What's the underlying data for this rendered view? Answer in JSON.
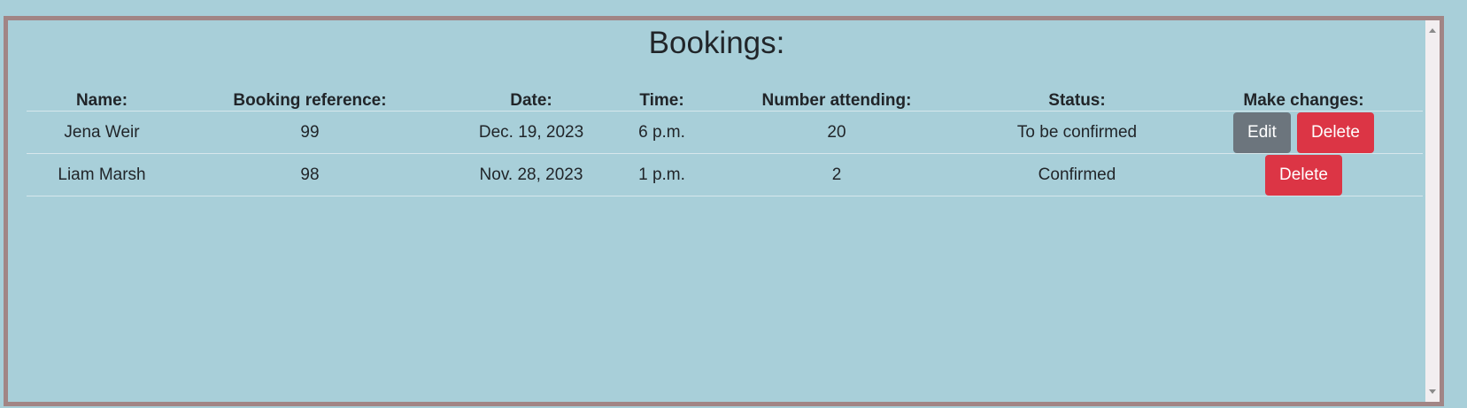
{
  "page": {
    "title": "Bookings:"
  },
  "table": {
    "headers": {
      "name": "Name:",
      "reference": "Booking reference:",
      "date": "Date:",
      "time": "Time:",
      "attending": "Number attending:",
      "status": "Status:",
      "actions": "Make changes:"
    },
    "rows": [
      {
        "name": "Jena Weir",
        "reference": "99",
        "date": "Dec. 19, 2023",
        "time": "6 p.m.",
        "attending": "20",
        "status": "To be confirmed",
        "edit_label": "Edit",
        "delete_label": "Delete"
      },
      {
        "name": "Liam Marsh",
        "reference": "98",
        "date": "Nov. 28, 2023",
        "time": "1 p.m.",
        "attending": "2",
        "status": "Confirmed",
        "delete_label": "Delete"
      }
    ]
  },
  "colors": {
    "background": "#a8cfd9",
    "frame_border": "#a18585",
    "edit_button": "#6c757d",
    "delete_button": "#dc3545"
  }
}
